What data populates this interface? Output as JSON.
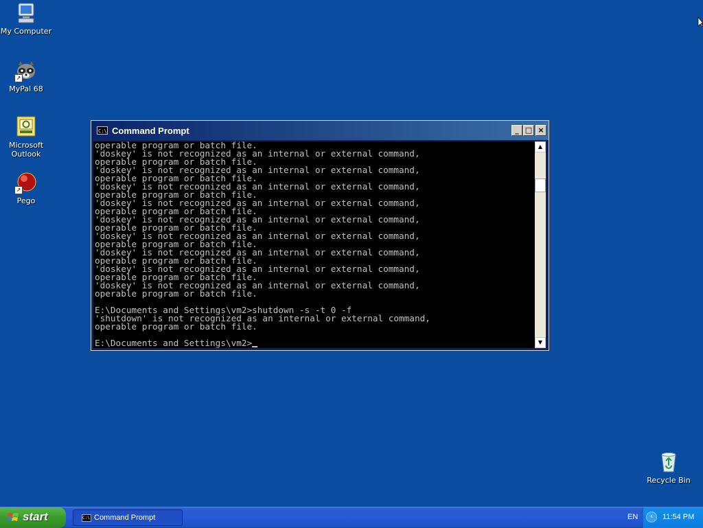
{
  "desktop": {
    "icons": [
      {
        "label": "My Computer",
        "icon": "computer-icon"
      },
      {
        "label": "MyPal 68",
        "icon": "raccoon-browser-icon"
      },
      {
        "label": "Microsoft Outlook",
        "icon": "outlook-icon"
      },
      {
        "label": "Pego",
        "icon": "red-ball-icon"
      },
      {
        "label": "Recycle Bin",
        "icon": "recycle-bin-icon"
      }
    ]
  },
  "window": {
    "title": "Command Prompt",
    "icon_text": "C:\\",
    "buttons": {
      "minimize": "_",
      "maximize": "□",
      "close": "×"
    },
    "console_text": "operable program or batch file.\n'doskey' is not recognized as an internal or external command,\noperable program or batch file.\n'doskey' is not recognized as an internal or external command,\noperable program or batch file.\n'doskey' is not recognized as an internal or external command,\noperable program or batch file.\n'doskey' is not recognized as an internal or external command,\noperable program or batch file.\n'doskey' is not recognized as an internal or external command,\noperable program or batch file.\n'doskey' is not recognized as an internal or external command,\noperable program or batch file.\n'doskey' is not recognized as an internal or external command,\noperable program or batch file.\n'doskey' is not recognized as an internal or external command,\noperable program or batch file.\n'doskey' is not recognized as an internal or external command,\noperable program or batch file.\n\nE:\\Documents and Settings\\vm2>shutdown -s -t 0 -f\n'shutdown' is not recognized as an internal or external command,\noperable program or batch file.\n\nE:\\Documents and Settings\\vm2>",
    "scroll": {
      "up": "▲",
      "down": "▼"
    }
  },
  "taskbar": {
    "start_label": "start",
    "tasks": [
      {
        "label": "Command Prompt",
        "icon_text": "C:\\"
      }
    ],
    "language": "EN",
    "tray_chevron": "‹",
    "clock": "11:54 PM"
  },
  "colors": {
    "desktop": "#0a4da0",
    "console_bg": "#000000",
    "console_fg": "#c0c0c0",
    "taskbar": "#245ad8",
    "start": "#3d9b2e"
  }
}
